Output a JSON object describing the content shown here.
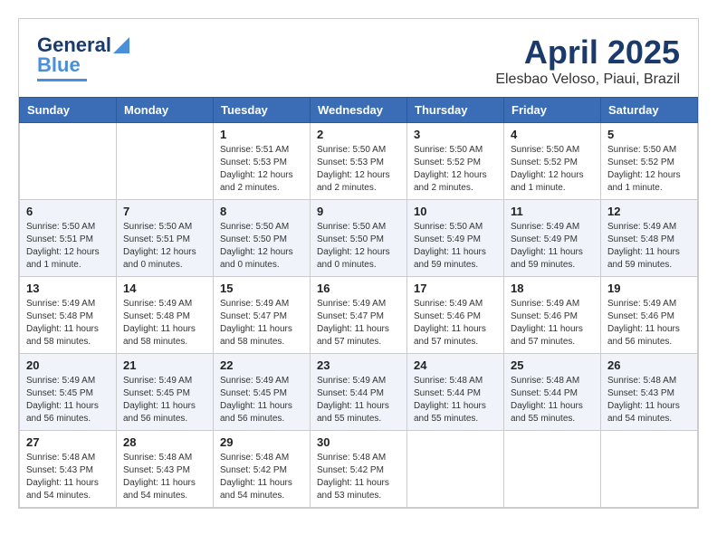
{
  "header": {
    "logo_general": "General",
    "logo_blue": "Blue",
    "month_year": "April 2025",
    "location": "Elesbao Veloso, Piaui, Brazil"
  },
  "weekdays": [
    "Sunday",
    "Monday",
    "Tuesday",
    "Wednesday",
    "Thursday",
    "Friday",
    "Saturday"
  ],
  "weeks": [
    [
      {
        "day": "",
        "sunrise": "",
        "sunset": "",
        "daylight": ""
      },
      {
        "day": "",
        "sunrise": "",
        "sunset": "",
        "daylight": ""
      },
      {
        "day": "1",
        "sunrise": "Sunrise: 5:51 AM",
        "sunset": "Sunset: 5:53 PM",
        "daylight": "Daylight: 12 hours and 2 minutes."
      },
      {
        "day": "2",
        "sunrise": "Sunrise: 5:50 AM",
        "sunset": "Sunset: 5:53 PM",
        "daylight": "Daylight: 12 hours and 2 minutes."
      },
      {
        "day": "3",
        "sunrise": "Sunrise: 5:50 AM",
        "sunset": "Sunset: 5:52 PM",
        "daylight": "Daylight: 12 hours and 2 minutes."
      },
      {
        "day": "4",
        "sunrise": "Sunrise: 5:50 AM",
        "sunset": "Sunset: 5:52 PM",
        "daylight": "Daylight: 12 hours and 1 minute."
      },
      {
        "day": "5",
        "sunrise": "Sunrise: 5:50 AM",
        "sunset": "Sunset: 5:52 PM",
        "daylight": "Daylight: 12 hours and 1 minute."
      }
    ],
    [
      {
        "day": "6",
        "sunrise": "Sunrise: 5:50 AM",
        "sunset": "Sunset: 5:51 PM",
        "daylight": "Daylight: 12 hours and 1 minute."
      },
      {
        "day": "7",
        "sunrise": "Sunrise: 5:50 AM",
        "sunset": "Sunset: 5:51 PM",
        "daylight": "Daylight: 12 hours and 0 minutes."
      },
      {
        "day": "8",
        "sunrise": "Sunrise: 5:50 AM",
        "sunset": "Sunset: 5:50 PM",
        "daylight": "Daylight: 12 hours and 0 minutes."
      },
      {
        "day": "9",
        "sunrise": "Sunrise: 5:50 AM",
        "sunset": "Sunset: 5:50 PM",
        "daylight": "Daylight: 12 hours and 0 minutes."
      },
      {
        "day": "10",
        "sunrise": "Sunrise: 5:50 AM",
        "sunset": "Sunset: 5:49 PM",
        "daylight": "Daylight: 11 hours and 59 minutes."
      },
      {
        "day": "11",
        "sunrise": "Sunrise: 5:49 AM",
        "sunset": "Sunset: 5:49 PM",
        "daylight": "Daylight: 11 hours and 59 minutes."
      },
      {
        "day": "12",
        "sunrise": "Sunrise: 5:49 AM",
        "sunset": "Sunset: 5:48 PM",
        "daylight": "Daylight: 11 hours and 59 minutes."
      }
    ],
    [
      {
        "day": "13",
        "sunrise": "Sunrise: 5:49 AM",
        "sunset": "Sunset: 5:48 PM",
        "daylight": "Daylight: 11 hours and 58 minutes."
      },
      {
        "day": "14",
        "sunrise": "Sunrise: 5:49 AM",
        "sunset": "Sunset: 5:48 PM",
        "daylight": "Daylight: 11 hours and 58 minutes."
      },
      {
        "day": "15",
        "sunrise": "Sunrise: 5:49 AM",
        "sunset": "Sunset: 5:47 PM",
        "daylight": "Daylight: 11 hours and 58 minutes."
      },
      {
        "day": "16",
        "sunrise": "Sunrise: 5:49 AM",
        "sunset": "Sunset: 5:47 PM",
        "daylight": "Daylight: 11 hours and 57 minutes."
      },
      {
        "day": "17",
        "sunrise": "Sunrise: 5:49 AM",
        "sunset": "Sunset: 5:46 PM",
        "daylight": "Daylight: 11 hours and 57 minutes."
      },
      {
        "day": "18",
        "sunrise": "Sunrise: 5:49 AM",
        "sunset": "Sunset: 5:46 PM",
        "daylight": "Daylight: 11 hours and 57 minutes."
      },
      {
        "day": "19",
        "sunrise": "Sunrise: 5:49 AM",
        "sunset": "Sunset: 5:46 PM",
        "daylight": "Daylight: 11 hours and 56 minutes."
      }
    ],
    [
      {
        "day": "20",
        "sunrise": "Sunrise: 5:49 AM",
        "sunset": "Sunset: 5:45 PM",
        "daylight": "Daylight: 11 hours and 56 minutes."
      },
      {
        "day": "21",
        "sunrise": "Sunrise: 5:49 AM",
        "sunset": "Sunset: 5:45 PM",
        "daylight": "Daylight: 11 hours and 56 minutes."
      },
      {
        "day": "22",
        "sunrise": "Sunrise: 5:49 AM",
        "sunset": "Sunset: 5:45 PM",
        "daylight": "Daylight: 11 hours and 56 minutes."
      },
      {
        "day": "23",
        "sunrise": "Sunrise: 5:49 AM",
        "sunset": "Sunset: 5:44 PM",
        "daylight": "Daylight: 11 hours and 55 minutes."
      },
      {
        "day": "24",
        "sunrise": "Sunrise: 5:48 AM",
        "sunset": "Sunset: 5:44 PM",
        "daylight": "Daylight: 11 hours and 55 minutes."
      },
      {
        "day": "25",
        "sunrise": "Sunrise: 5:48 AM",
        "sunset": "Sunset: 5:44 PM",
        "daylight": "Daylight: 11 hours and 55 minutes."
      },
      {
        "day": "26",
        "sunrise": "Sunrise: 5:48 AM",
        "sunset": "Sunset: 5:43 PM",
        "daylight": "Daylight: 11 hours and 54 minutes."
      }
    ],
    [
      {
        "day": "27",
        "sunrise": "Sunrise: 5:48 AM",
        "sunset": "Sunset: 5:43 PM",
        "daylight": "Daylight: 11 hours and 54 minutes."
      },
      {
        "day": "28",
        "sunrise": "Sunrise: 5:48 AM",
        "sunset": "Sunset: 5:43 PM",
        "daylight": "Daylight: 11 hours and 54 minutes."
      },
      {
        "day": "29",
        "sunrise": "Sunrise: 5:48 AM",
        "sunset": "Sunset: 5:42 PM",
        "daylight": "Daylight: 11 hours and 54 minutes."
      },
      {
        "day": "30",
        "sunrise": "Sunrise: 5:48 AM",
        "sunset": "Sunset: 5:42 PM",
        "daylight": "Daylight: 11 hours and 53 minutes."
      },
      {
        "day": "",
        "sunrise": "",
        "sunset": "",
        "daylight": ""
      },
      {
        "day": "",
        "sunrise": "",
        "sunset": "",
        "daylight": ""
      },
      {
        "day": "",
        "sunrise": "",
        "sunset": "",
        "daylight": ""
      }
    ]
  ]
}
